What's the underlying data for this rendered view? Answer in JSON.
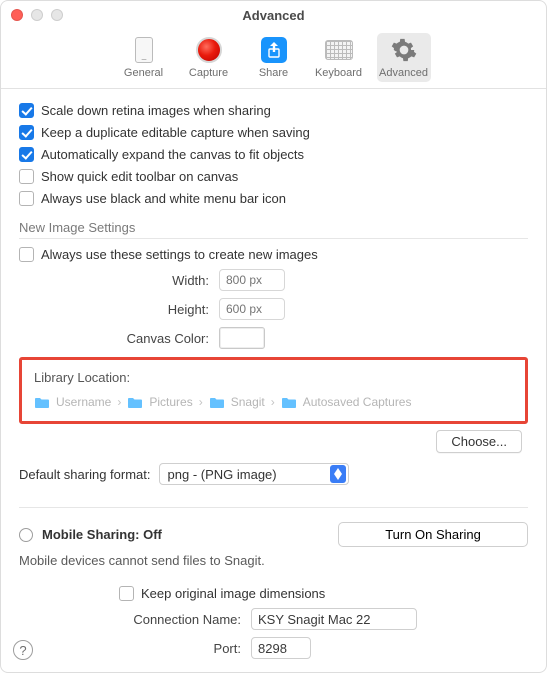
{
  "window": {
    "title": "Advanced"
  },
  "toolbar": {
    "general": "General",
    "capture": "Capture",
    "share": "Share",
    "keyboard": "Keyboard",
    "advanced": "Advanced"
  },
  "checks": {
    "scale_down": "Scale down retina images when sharing",
    "keep_dup": "Keep a duplicate editable capture when saving",
    "auto_expand": "Automatically expand the canvas to fit objects",
    "quick_edit": "Show quick edit toolbar on canvas",
    "bw_menubar": "Always use black and white menu bar icon"
  },
  "new_image": {
    "header": "New Image Settings",
    "always": "Always use these settings to create new images",
    "width_label": "Width:",
    "width_value": "800 px",
    "height_label": "Height:",
    "height_value": "600 px",
    "canvas_color_label": "Canvas Color:"
  },
  "library": {
    "title": "Library Location:",
    "segments": [
      "Username",
      "Pictures",
      "Snagit",
      "Autosaved Captures"
    ],
    "choose": "Choose..."
  },
  "sharing_fmt": {
    "label": "Default sharing format:",
    "value": "png - (PNG image)"
  },
  "mobile": {
    "label": "Mobile Sharing: Off",
    "button": "Turn On Sharing",
    "sub": "Mobile devices cannot send files to Snagit.",
    "keep": "Keep original image dimensions",
    "conn_label": "Connection Name:",
    "conn_value": "KSY Snagit Mac 22",
    "port_label": "Port:",
    "port_value": "8298"
  },
  "help": "?"
}
